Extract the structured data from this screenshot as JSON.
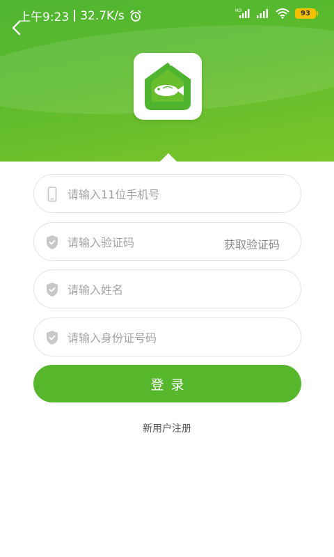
{
  "status_bar": {
    "time": "上午9:23",
    "speed": "32.7K/s",
    "battery": "93",
    "network_label": "HD"
  },
  "colors": {
    "brand_green": "#56b72d",
    "header_green_start": "#4fb531",
    "header_green_end": "#7cc52b",
    "battery_yellow": "#f2c100"
  },
  "header": {
    "back_icon": "chevron-left-icon",
    "logo_icon": "house-fish-logo-icon"
  },
  "form": {
    "phone": {
      "placeholder": "请输入11位手机号",
      "value": "",
      "icon": "phone-icon"
    },
    "code": {
      "placeholder": "请输入验证码",
      "value": "",
      "icon": "shield-icon",
      "action_label": "获取验证码"
    },
    "name": {
      "placeholder": "请输入姓名",
      "value": "",
      "icon": "shield-icon"
    },
    "id_number": {
      "placeholder": "请输入身份证号码",
      "value": "",
      "icon": "shield-icon"
    },
    "login_label": "登录",
    "register_label": "新用户注册"
  }
}
